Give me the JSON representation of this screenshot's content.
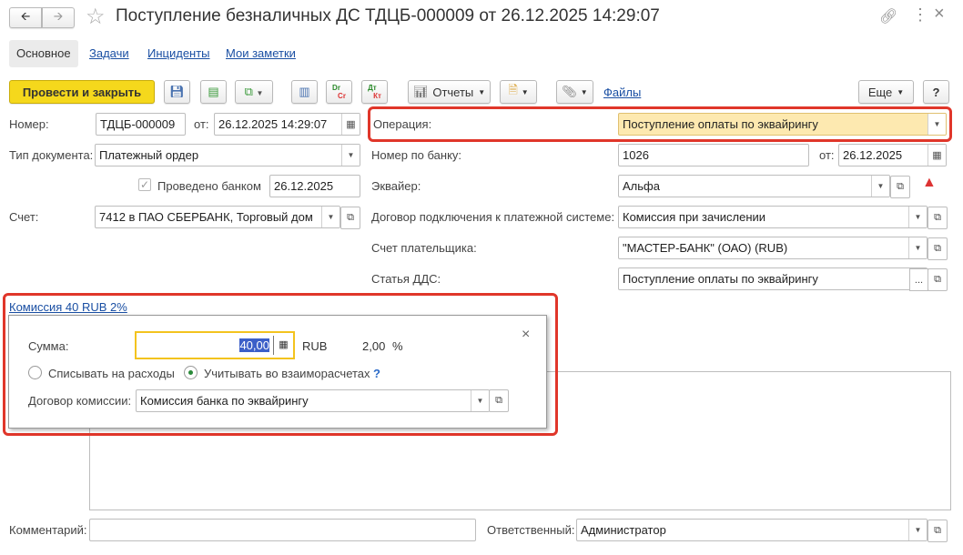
{
  "header": {
    "title": "Поступление безналичных ДС ТДЦБ-000009 от 26.12.2025 14:29:07",
    "back_icon": "arrow-left",
    "forward_icon": "arrow-right",
    "star_icon": "star",
    "link_icon": "link",
    "more_icon": "more-vertical",
    "close_icon": "close"
  },
  "tabs": [
    {
      "label": "Основное",
      "active": true
    },
    {
      "label": "Задачи"
    },
    {
      "label": "Инциденты"
    },
    {
      "label": "Мои заметки"
    }
  ],
  "toolbar": {
    "post_close": "Провести и закрыть",
    "reports": "Отчеты",
    "files": "Файлы",
    "more": "Еще",
    "help": "?",
    "dr": "Dr",
    "cr": "Cr",
    "dt": "Дт",
    "kt": "Кт"
  },
  "form": {
    "number_label": "Номер:",
    "number": "ТДЦБ-000009",
    "from_label": "от:",
    "date": "26.12.2025 14:29:07",
    "doc_type_label": "Тип документа:",
    "doc_type": "Платежный ордер",
    "bank_done_label": "Проведено банком",
    "bank_done_checked": true,
    "bank_done_date": "26.12.2025",
    "account_label": "Счет:",
    "account": "7412 в ПАО СБЕРБАНК, Торговый дом",
    "operation_label": "Операция:",
    "operation": "Поступление оплаты по эквайрингу",
    "bank_number_label": "Номер по банку:",
    "bank_number": "1026",
    "bank_date_label": "от:",
    "bank_date": "26.12.2025",
    "acquirer_label": "Эквайер:",
    "acquirer": "Альфа",
    "contract_label": "Договор подключения к платежной системе:",
    "contract": "Комиссия при зачислении",
    "payer_account_label": "Счет плательщика:",
    "payer_account": "\"МАСТЕР-БАНК\" (ОАО) (RUB)",
    "dds_label": "Статья ДДС:",
    "dds": "Поступление оплаты по эквайрингу",
    "dds_button": "...",
    "comment_label": "Комментарий:",
    "comment": "",
    "responsible_label": "Ответственный:",
    "responsible": "Администратор"
  },
  "commission": {
    "link": "Комиссия 40 RUB 2%",
    "sum_label": "Сумма:",
    "sum": "40,00",
    "currency": "RUB",
    "percent": "2,00",
    "percent_sign": "%",
    "option1": "Списывать на расходы",
    "option2": "Учитывать во взаиморасчетах",
    "selected_option": 2,
    "help": "?",
    "contract_label": "Договор комиссии:",
    "contract": "Комиссия банка по эквайрингу",
    "close": "×"
  },
  "colors": {
    "primary_button": "#f5d81c",
    "highlight": "#e0362a",
    "operation_bg": "#fde9b0",
    "focus": "#f3c31e"
  }
}
